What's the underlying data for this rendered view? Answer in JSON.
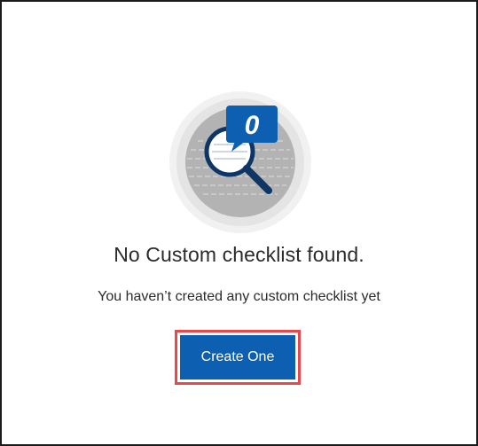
{
  "empty_state": {
    "badge_count": "0",
    "illustration_icon": "magnifier-icon",
    "title": "No Custom checklist found.",
    "subtitle": "You haven’t created any custom checklist yet",
    "create_button_label": "Create One"
  },
  "colors": {
    "primary": "#0d5fb1",
    "highlight_border": "#e8474c",
    "text": "#2b2b2b",
    "illustration_gray": "#b3b3b3"
  }
}
